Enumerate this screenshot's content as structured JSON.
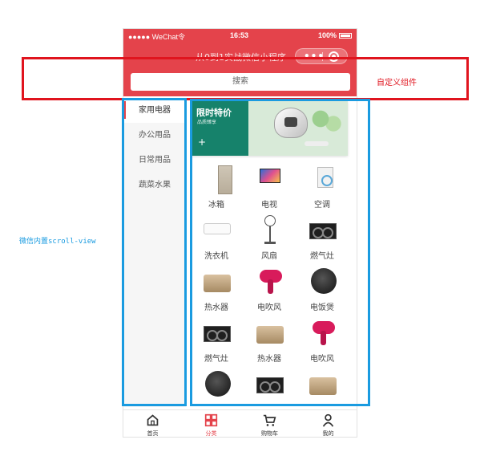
{
  "statusbar": {
    "signal": "●●●●● WeChat令",
    "time": "16:53",
    "battery": "100%"
  },
  "navbar": {
    "title": "从0到1实战微信小程序",
    "capsule_dots": "•••"
  },
  "search": {
    "placeholder": "搜索"
  },
  "sidebar": {
    "items": [
      {
        "label": "家用电器",
        "active": true
      },
      {
        "label": "办公用品",
        "active": false
      },
      {
        "label": "日常用品",
        "active": false
      },
      {
        "label": "蔬菜水果",
        "active": false
      }
    ]
  },
  "banner": {
    "title": "限时特价",
    "subtitle": "品质臻享",
    "plus": "+"
  },
  "products": [
    {
      "label": "冰箱",
      "icon": "fridge"
    },
    {
      "label": "电视",
      "icon": "tv"
    },
    {
      "label": "空调",
      "icon": "washer"
    },
    {
      "label": "洗衣机",
      "icon": "air-conditioner"
    },
    {
      "label": "风扇",
      "icon": "fan"
    },
    {
      "label": "燃气灶",
      "icon": "gas-stove"
    },
    {
      "label": "热水器",
      "icon": "water-heater"
    },
    {
      "label": "电吹风",
      "icon": "hair-dryer"
    },
    {
      "label": "电饭煲",
      "icon": "rice-cooker"
    },
    {
      "label": "燃气灶",
      "icon": "gas-stove"
    },
    {
      "label": "热水器",
      "icon": "water-heater"
    },
    {
      "label": "电吹风",
      "icon": "hair-dryer"
    },
    {
      "label": "",
      "icon": "rice-cooker"
    },
    {
      "label": "",
      "icon": "gas-stove"
    },
    {
      "label": "",
      "icon": "water-heater"
    }
  ],
  "tabbar": {
    "items": [
      {
        "label": "首页",
        "icon": "home-icon",
        "active": false
      },
      {
        "label": "分类",
        "icon": "category-icon",
        "active": true
      },
      {
        "label": "购物车",
        "icon": "cart-icon",
        "active": false
      },
      {
        "label": "我的",
        "icon": "user-icon",
        "active": false
      }
    ]
  },
  "annotations": {
    "custom_component": "自定义组件",
    "scroll_view": "微信内置scroll-view"
  },
  "colors": {
    "brand": "#e4434b",
    "annotation_red": "#e0141e",
    "annotation_blue": "#1a9be0"
  }
}
